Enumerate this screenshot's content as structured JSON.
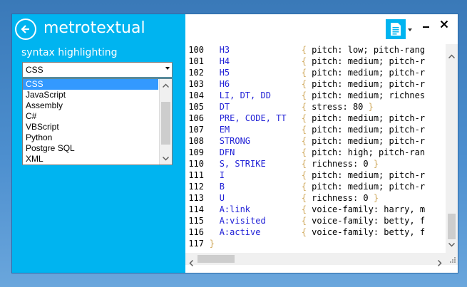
{
  "app": {
    "title": "metrotextual"
  },
  "sidebar": {
    "section_label": "syntax highlighting",
    "combo_value": "CSS",
    "dropdown_options": [
      "CSS",
      "JavaScript",
      "Assembly",
      "C#",
      "VBScript",
      "Python",
      "Postgre SQL",
      "XML"
    ],
    "selected_index": 0
  },
  "editor": {
    "lines": [
      {
        "n": "100",
        "sel": "H3",
        "body": "pitch: low; pitch-rang"
      },
      {
        "n": "101",
        "sel": "H4",
        "body": "pitch: medium; pitch-r"
      },
      {
        "n": "102",
        "sel": "H5",
        "body": "pitch: medium; pitch-r"
      },
      {
        "n": "103",
        "sel": "H6",
        "body": "pitch: medium; pitch-r"
      },
      {
        "n": "104",
        "sel": "LI, DT, DD",
        "body": "pitch: medium; richnes"
      },
      {
        "n": "105",
        "sel": "DT",
        "body": "stress: 80 }"
      },
      {
        "n": "106",
        "sel": "PRE, CODE, TT",
        "body": "pitch: medium; pitch-r"
      },
      {
        "n": "107",
        "sel": "EM",
        "body": "pitch: medium; pitch-r"
      },
      {
        "n": "108",
        "sel": "STRONG",
        "body": "pitch: medium; pitch-r"
      },
      {
        "n": "109",
        "sel": "DFN",
        "body": "pitch: high; pitch-ran"
      },
      {
        "n": "110",
        "sel": "S, STRIKE",
        "body": "richness: 0 }"
      },
      {
        "n": "111",
        "sel": "I",
        "body": "pitch: medium; pitch-r"
      },
      {
        "n": "112",
        "sel": "B",
        "body": "pitch: medium; pitch-r"
      },
      {
        "n": "113",
        "sel": "U",
        "body": "richness: 0 }"
      },
      {
        "n": "114",
        "sel": "A:link",
        "body": "voice-family: harry, m"
      },
      {
        "n": "115",
        "sel": "A:visited",
        "body": "voice-family: betty, f"
      },
      {
        "n": "116",
        "sel": "A:active",
        "body": "voice-family: betty, f"
      },
      {
        "n": "117",
        "sel": "}",
        "body": ""
      }
    ]
  },
  "colors": {
    "accent": "#00b4f0",
    "selector": "#1f1fd6",
    "brace": "#cfa85b",
    "selection": "#3399ff"
  },
  "icons": {
    "back": "back-arrow-icon",
    "document": "document-icon",
    "minimize": "minimize-icon",
    "close": "close-icon"
  }
}
